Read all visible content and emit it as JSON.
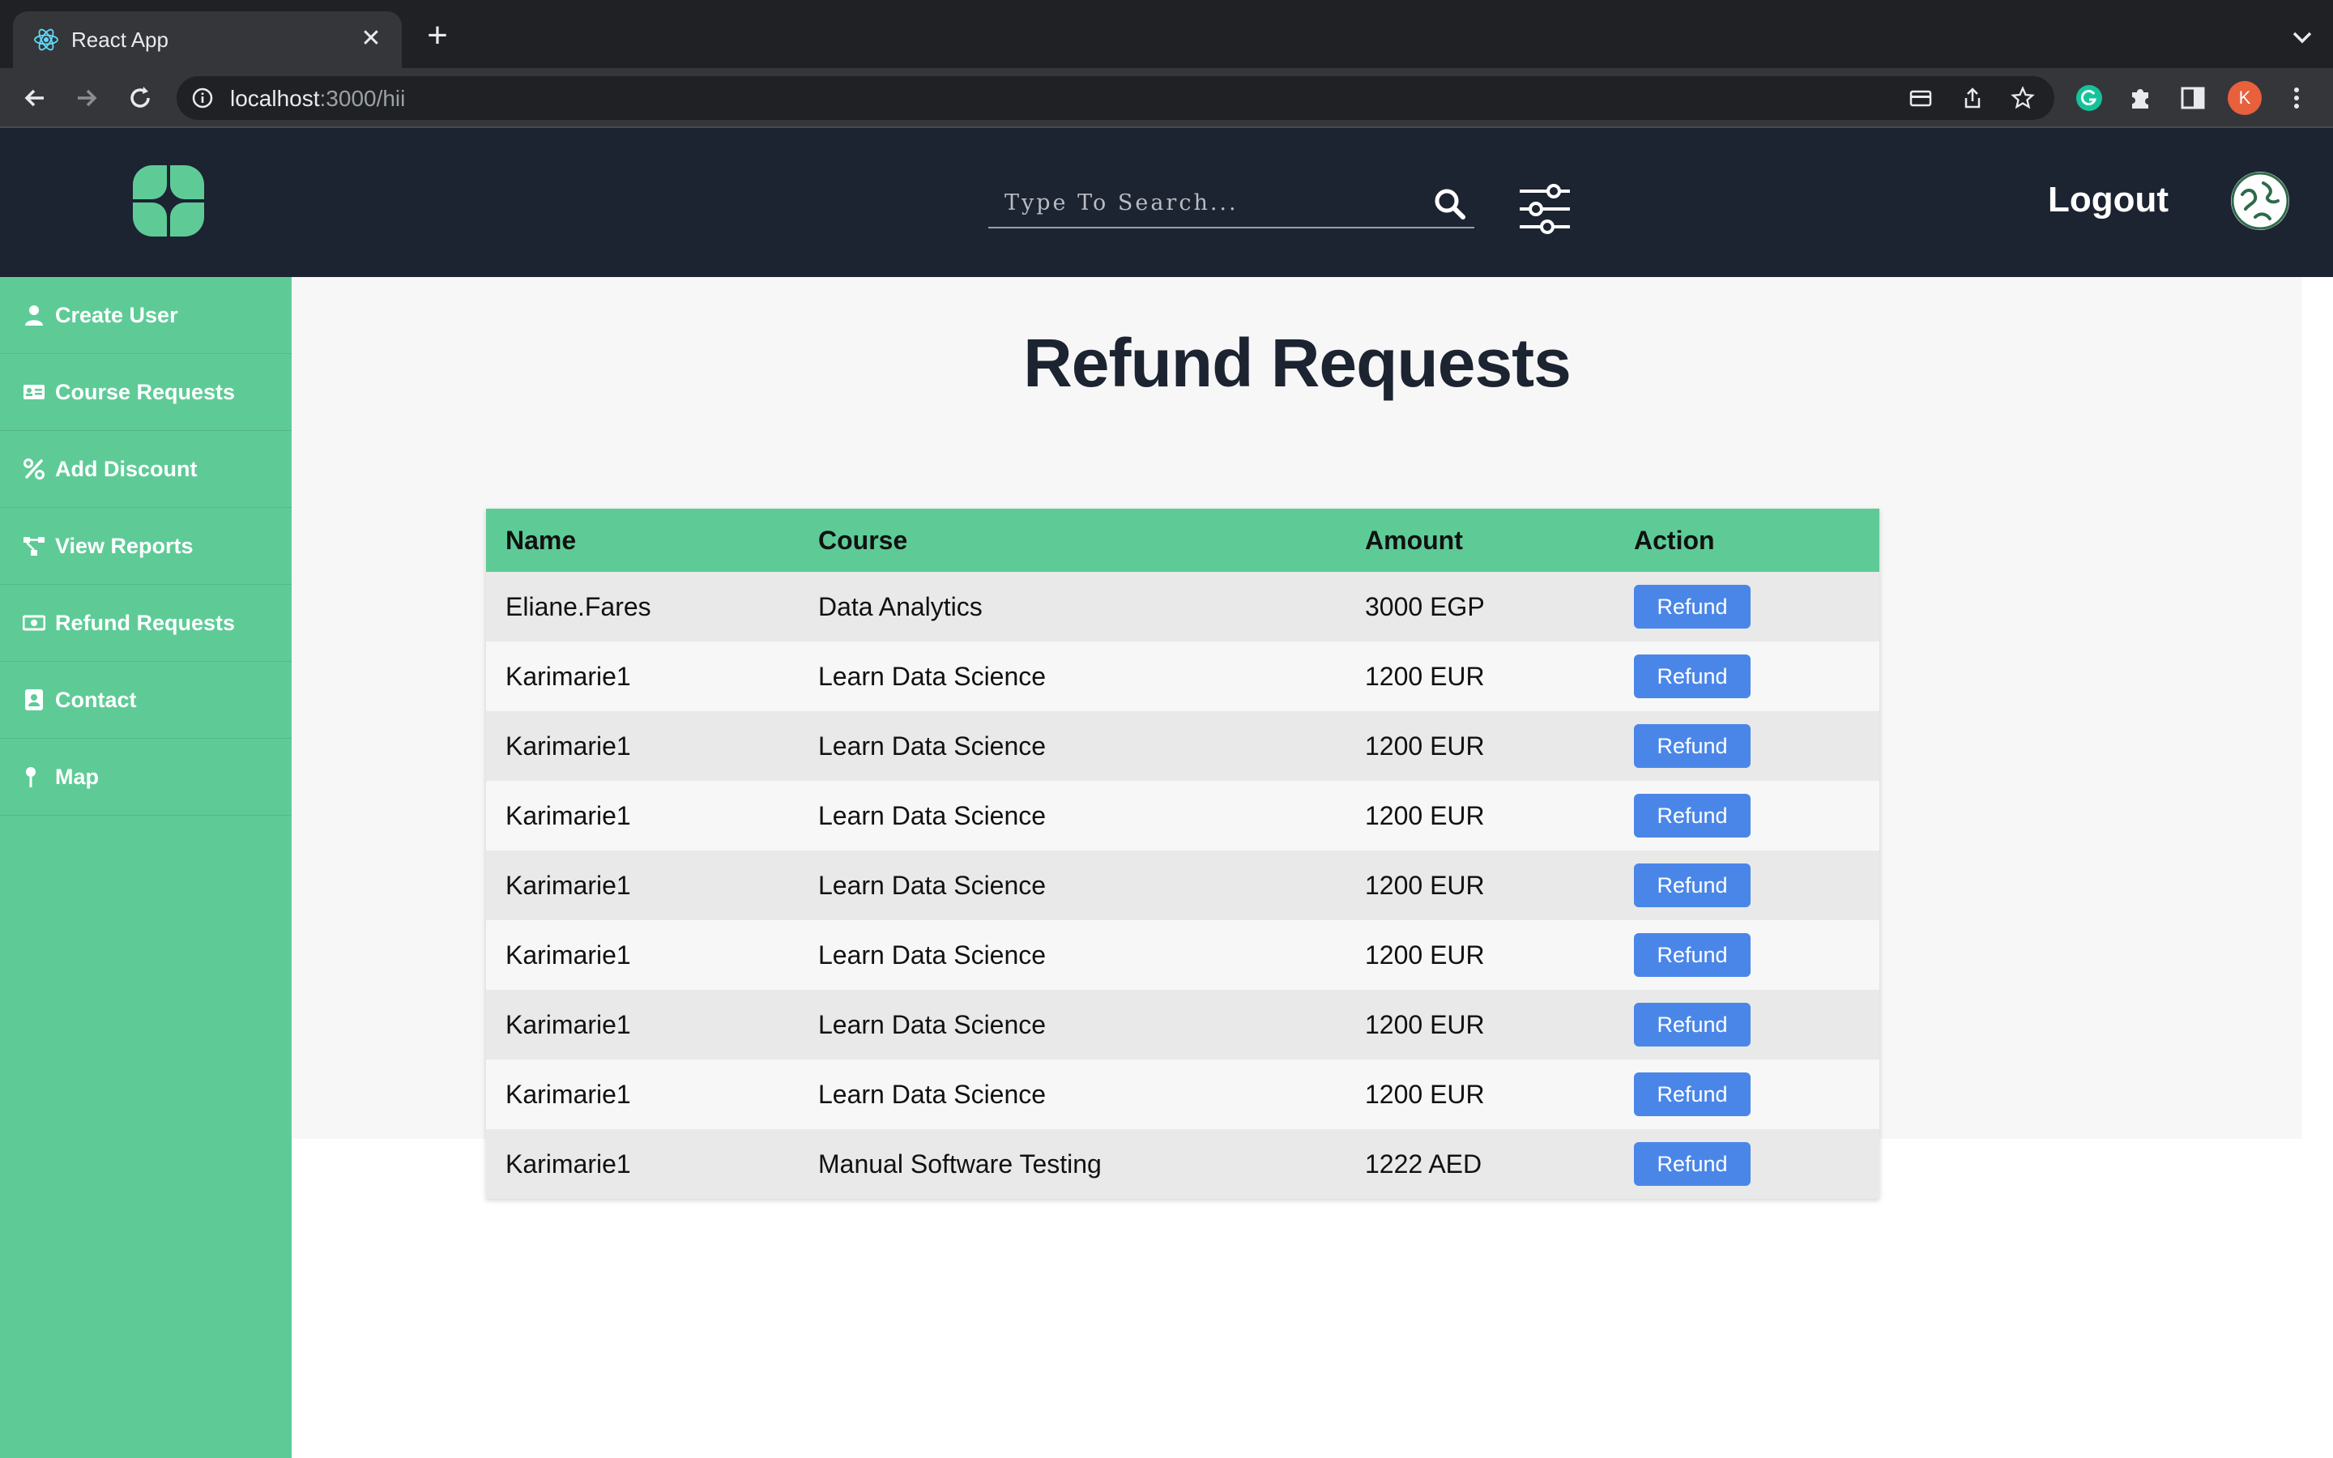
{
  "browser": {
    "tab_title": "React App",
    "url_host": "localhost",
    "url_rest": ":3000/hii",
    "profile_initial": "K"
  },
  "header": {
    "search_placeholder": "Type To Search...",
    "logout_label": "Logout"
  },
  "sidebar": {
    "items": [
      {
        "label": "Create User",
        "icon": "user-icon"
      },
      {
        "label": "Course Requests",
        "icon": "id-card-icon"
      },
      {
        "label": "Add Discount",
        "icon": "percent-icon"
      },
      {
        "label": "View Reports",
        "icon": "network-icon"
      },
      {
        "label": "Refund Requests",
        "icon": "money-bill-icon"
      },
      {
        "label": "Contact",
        "icon": "address-book-icon"
      },
      {
        "label": "Map",
        "icon": "map-pin-icon"
      }
    ]
  },
  "main": {
    "title": "Refund Requests",
    "table": {
      "headers": [
        "Name",
        "Course",
        "Amount",
        "Action"
      ],
      "rows": [
        {
          "name": "Eliane.Fares",
          "course": "Data Analytics",
          "amount": "3000 EGP",
          "action": "Refund"
        },
        {
          "name": "Karimarie1",
          "course": "Learn Data Science",
          "amount": "1200 EUR",
          "action": "Refund"
        },
        {
          "name": "Karimarie1",
          "course": "Learn Data Science",
          "amount": "1200 EUR",
          "action": "Refund"
        },
        {
          "name": "Karimarie1",
          "course": "Learn Data Science",
          "amount": "1200 EUR",
          "action": "Refund"
        },
        {
          "name": "Karimarie1",
          "course": "Learn Data Science",
          "amount": "1200 EUR",
          "action": "Refund"
        },
        {
          "name": "Karimarie1",
          "course": "Learn Data Science",
          "amount": "1200 EUR",
          "action": "Refund"
        },
        {
          "name": "Karimarie1",
          "course": "Learn Data Science",
          "amount": "1200 EUR",
          "action": "Refund"
        },
        {
          "name": "Karimarie1",
          "course": "Learn Data Science",
          "amount": "1200 EUR",
          "action": "Refund"
        },
        {
          "name": "Karimarie1",
          "course": "Manual Software Testing",
          "amount": "1222 AED",
          "action": "Refund"
        }
      ]
    }
  },
  "colors": {
    "accent_green": "#5ecb97",
    "header_dark": "#1c2331",
    "button_blue": "#4a86e8"
  }
}
